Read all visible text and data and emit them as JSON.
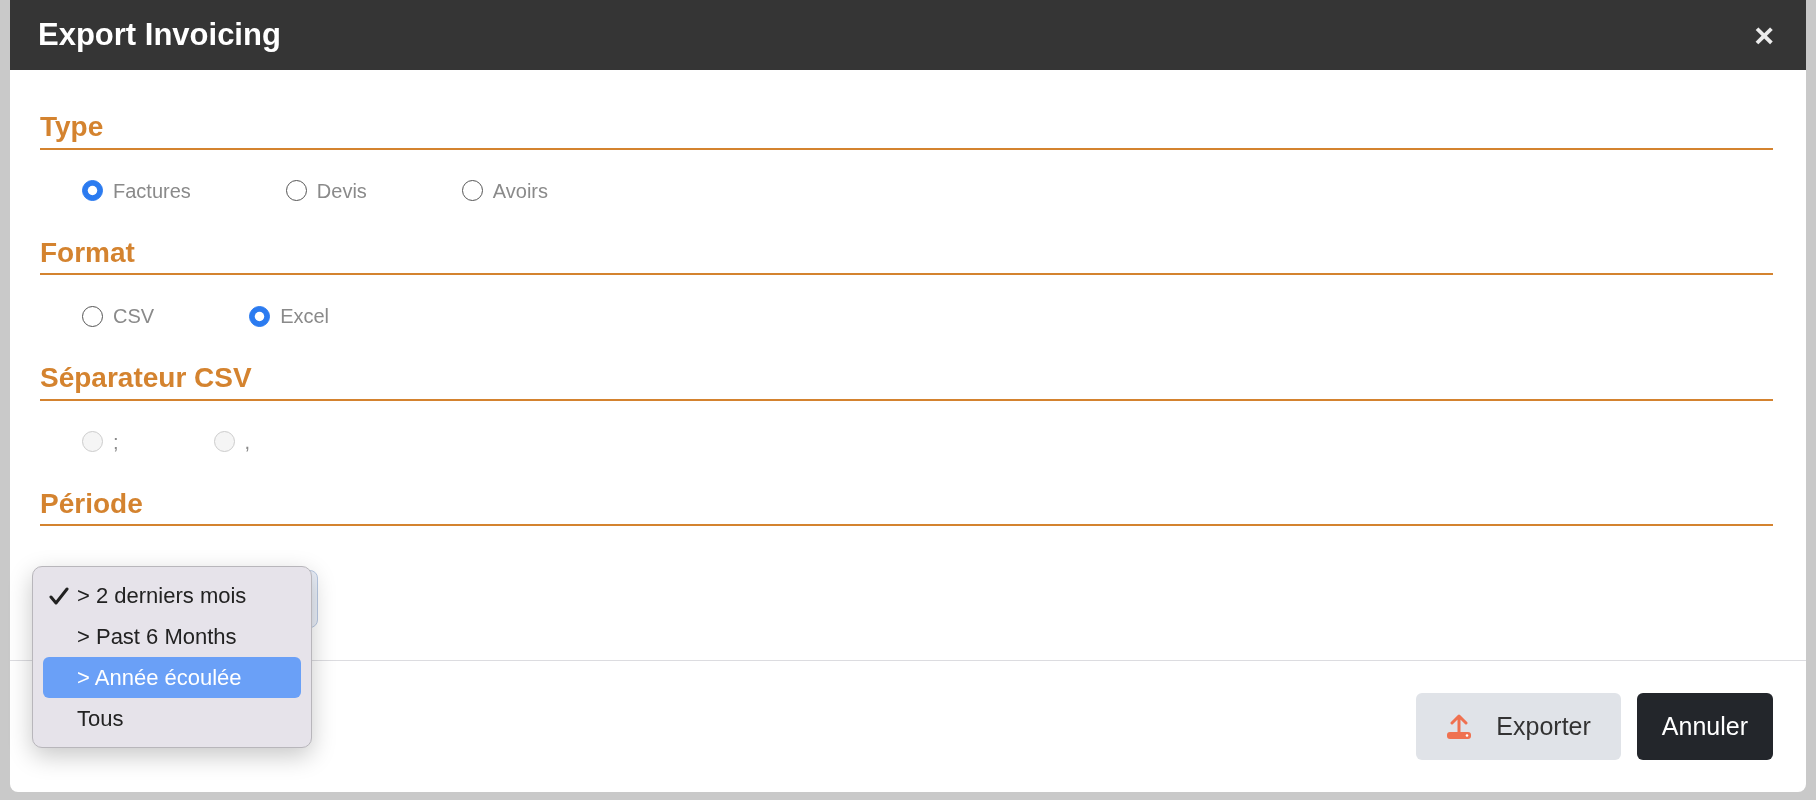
{
  "dialog": {
    "title": "Export Invoicing",
    "close": "×"
  },
  "sections": [
    {
      "heading": "Type",
      "kind": "radios",
      "disabled": false,
      "options": [
        {
          "label": "Factures",
          "selected": true
        },
        {
          "label": "Devis",
          "selected": false
        },
        {
          "label": "Avoirs",
          "selected": false
        }
      ]
    },
    {
      "heading": "Format",
      "kind": "radios",
      "disabled": false,
      "options": [
        {
          "label": "CSV",
          "selected": false
        },
        {
          "label": "Excel",
          "selected": true
        }
      ]
    },
    {
      "heading": "Séparateur CSV",
      "kind": "radios",
      "disabled": true,
      "options": [
        {
          "label": ";",
          "selected": false
        },
        {
          "label": ",",
          "selected": false
        }
      ]
    },
    {
      "heading": "Période",
      "kind": "select",
      "menu": [
        {
          "label": "> 2 derniers mois",
          "selected": true,
          "highlighted": false
        },
        {
          "label": "> Past 6 Months",
          "selected": false,
          "highlighted": false
        },
        {
          "label": "> Année écoulée",
          "selected": false,
          "highlighted": true
        },
        {
          "label": "Tous",
          "selected": false,
          "highlighted": false
        }
      ]
    }
  ],
  "buttons": [
    {
      "label": "Exporter",
      "kind": "export"
    },
    {
      "label": "Annuler",
      "kind": "cancel"
    }
  ]
}
